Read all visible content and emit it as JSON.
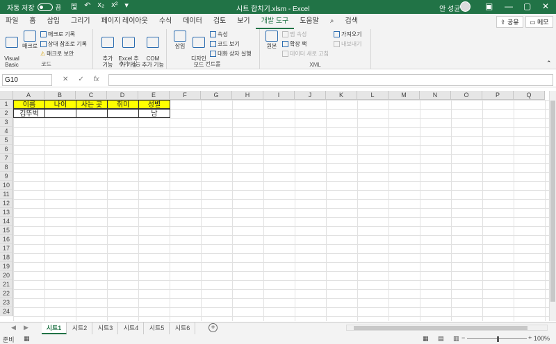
{
  "titlebar": {
    "autosave_label": "자동 저장",
    "autosave_state": "끔",
    "title": "시트 합치기.xlsm  -  Excel",
    "user": "안 성균",
    "minimize": "—",
    "restore": "▢",
    "close": "✕"
  },
  "menu": {
    "tabs": [
      "파일",
      "홈",
      "삽입",
      "그리기",
      "페이지 레이아웃",
      "수식",
      "데이터",
      "검토",
      "보기",
      "개발 도구",
      "도움말",
      "검색"
    ],
    "share": "공유",
    "memo": "메모"
  },
  "ribbon": {
    "code": {
      "label": "코드",
      "visual_basic": "Visual\nBasic",
      "macro": "매크로",
      "record_macro": "매크로 기록",
      "relative_ref": "상대 참조로 기록",
      "macro_security": "매크로 보안"
    },
    "addins": {
      "label": "추가 기능",
      "addins": "추가\n기능",
      "excel_addins": "Excel 추\n가 기능",
      "com_addins": "COM\n추가 기능"
    },
    "controls": {
      "label": "컨트롤",
      "insert": "삽입",
      "design_mode": "디자인\n모드",
      "properties": "속성",
      "view_code": "코드 보기",
      "run_dialog": "대화 상자 실행"
    },
    "xml": {
      "label": "XML",
      "source": "원본",
      "map_properties": "맵 속성",
      "expansion_packs": "확장 팩",
      "refresh_data": "데이터 새로 고침",
      "import": "가져오기",
      "export": "내보내기"
    }
  },
  "formula": {
    "namebox": "G10",
    "cancel": "✕",
    "enter": "✓",
    "fx": "fx",
    "value": ""
  },
  "grid": {
    "columns": [
      "A",
      "B",
      "C",
      "D",
      "E",
      "F",
      "G",
      "H",
      "I",
      "J",
      "K",
      "L",
      "M",
      "N",
      "O",
      "P",
      "Q"
    ],
    "rows": [
      "1",
      "2",
      "3",
      "4",
      "5",
      "6",
      "7",
      "8",
      "9",
      "10",
      "11",
      "12",
      "13",
      "14",
      "15",
      "16",
      "17",
      "18",
      "19",
      "20",
      "21",
      "22",
      "23",
      "24"
    ],
    "header_row": [
      "이름",
      "나이",
      "사는 곳",
      "취미",
      "성별"
    ],
    "data_row": [
      "김뚜벅",
      "",
      "",
      "",
      "남"
    ],
    "header_fill": "#ffff00"
  },
  "sheets": {
    "tabs": [
      "시트1",
      "시트2",
      "시트3",
      "시트4",
      "시트5",
      "시트6"
    ],
    "active": "시트1",
    "add": "+"
  },
  "status": {
    "ready": "준비",
    "zoom": "100%"
  },
  "colors": {
    "brand": "#217346"
  }
}
